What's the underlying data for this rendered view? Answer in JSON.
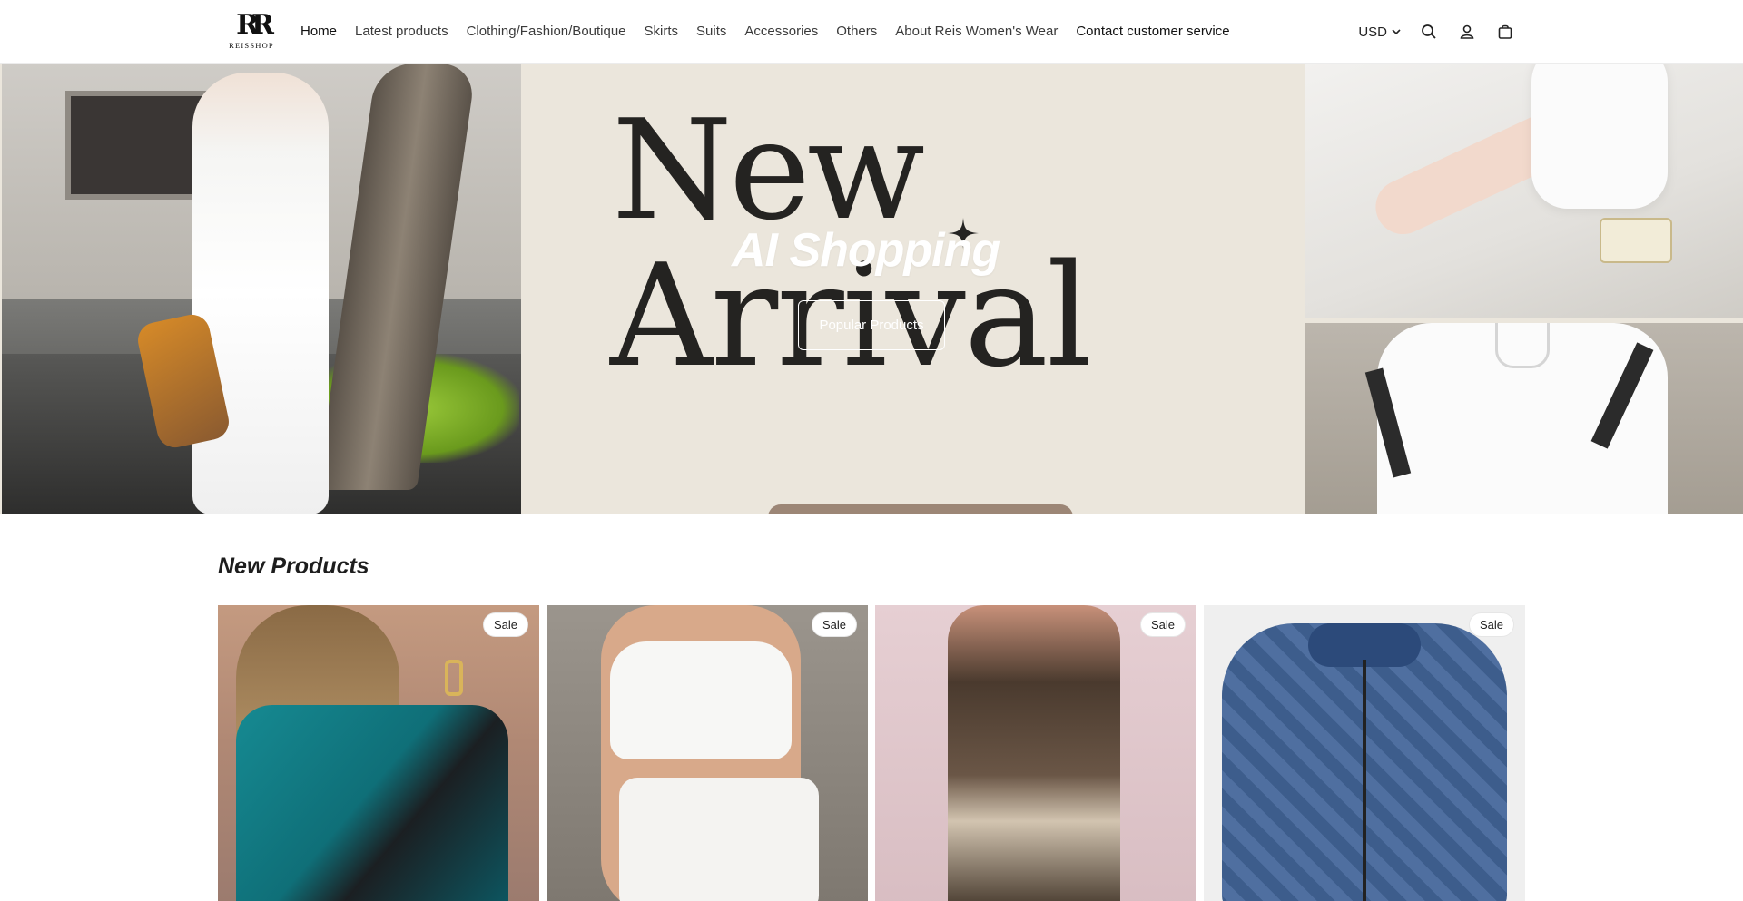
{
  "header": {
    "logo": {
      "mark": "RR",
      "wordmark": "REISSHOP"
    },
    "nav": [
      {
        "label": "Home",
        "active": true
      },
      {
        "label": "Latest products"
      },
      {
        "label": "Clothing/Fashion/Boutique"
      },
      {
        "label": "Skirts"
      },
      {
        "label": "Suits"
      },
      {
        "label": "Accessories"
      },
      {
        "label": "Others"
      },
      {
        "label": "About Reis Women's Wear"
      },
      {
        "label": "Contact customer service"
      }
    ],
    "currency": "USD",
    "icons": [
      "search-icon",
      "account-icon",
      "cart-icon"
    ]
  },
  "hero": {
    "big_line_1": "New",
    "big_line_2": "Arrival",
    "title": "AI Shopping",
    "button_label": "Popular Products"
  },
  "new_products": {
    "title": "New Products",
    "items": [
      {
        "badge": "Sale"
      },
      {
        "badge": "Sale"
      },
      {
        "badge": "Sale"
      },
      {
        "badge": "Sale"
      }
    ]
  },
  "colors": {
    "hero_bg": "#ebe6dc",
    "text": "#1f1f1f",
    "hero_text": "#242321"
  }
}
